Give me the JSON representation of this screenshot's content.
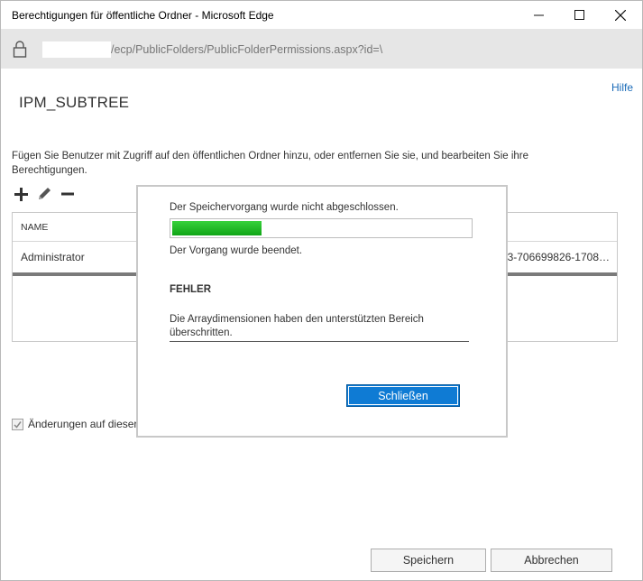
{
  "window": {
    "title": "Berechtigungen für öffentliche Ordner - Microsoft Edge",
    "url": "/ecp/PublicFolders/PublicFolderPermissions.aspx?id=\\"
  },
  "page": {
    "help": "Hilfe",
    "title": "IPM_SUBTREE",
    "description": "Fügen Sie Benutzer mit Zugriff auf den öffentlichen Ordner hinzu, oder entfernen Sie sie, und bearbeiten Sie ihre Berechtigungen.",
    "toolbar": {
      "icons": [
        "add-icon",
        "edit-icon",
        "remove-icon"
      ]
    },
    "table": {
      "column_name": "NAME",
      "rows": [
        {
          "name": "Administrator",
          "sid": "63-706699826-1708…"
        }
      ]
    },
    "checkbox_label": "Änderungen auf dieser",
    "checkbox_checked": true,
    "save_button": "Speichern",
    "cancel_button": "Abbrechen"
  },
  "dialog": {
    "status": "Der Speichervorgang wurde nicht abgeschlossen.",
    "progress": 0.3,
    "complete": "Der Vorgang wurde beendet.",
    "error_title": "FEHLER",
    "error_text": "Die Arraydimensionen haben den unterstützten Bereich überschritten.",
    "close_button": "Schließen"
  },
  "colors": {
    "accent": "#0f7bd4",
    "progress": "#10a516",
    "link": "#1a6bb8"
  }
}
